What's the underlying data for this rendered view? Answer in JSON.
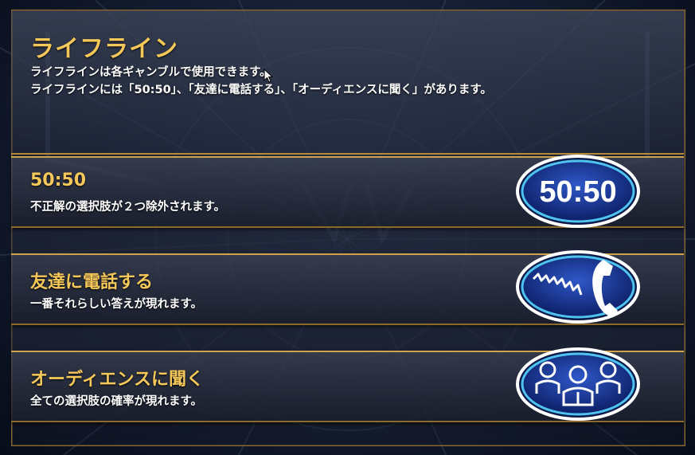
{
  "header": {
    "title": "ライフライン",
    "desc_line1": "ライフラインは各ギャンブルで使用できます。",
    "desc_line2": "ライフラインには「50:50」、「友達に電話する」、「オーディエンスに聞く」があります。"
  },
  "lifelines": [
    {
      "title": "50:50",
      "desc": "不正解の選択肢が２つ除外されます。",
      "badge_text": "50:50",
      "icon": "fifty-fifty-icon"
    },
    {
      "title": "友達に電話する",
      "desc": "一番それらしい答えが現れます。",
      "icon": "phone-a-friend-icon"
    },
    {
      "title": "オーディエンスに聞く",
      "desc": "全ての選択肢の確率が現れます。",
      "icon": "ask-the-audience-icon"
    }
  ],
  "colors": {
    "title_gold": "#f6c85a",
    "frame_gold": "#d2a24a",
    "badge_blue": "#1a3a9a",
    "badge_rim": "#4fc3f0"
  }
}
